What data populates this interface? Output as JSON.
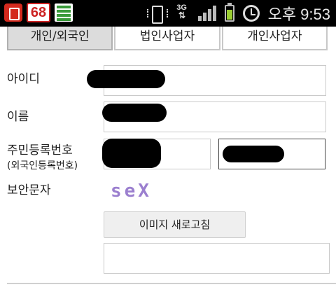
{
  "status_bar": {
    "notification_badge": "68",
    "time": "오후 9:53",
    "network_label": "3G",
    "icons": [
      "app-notification-icon",
      "badge-68-icon",
      "list-app-icon",
      "vibrate-icon",
      "3g-data-icon",
      "signal-icon",
      "battery-icon",
      "alarm-icon"
    ]
  },
  "tabs": [
    {
      "label": "개인/외국인",
      "active": true
    },
    {
      "label": "법인사업자",
      "active": false
    },
    {
      "label": "개인사업자",
      "active": false
    }
  ],
  "form": {
    "id_label": "아이디",
    "name_label": "이름",
    "rrn_label": "주민등록번호",
    "rrn_sublabel": "(외국인등록번호)",
    "security_label": "보안문자",
    "captcha_text": "seX",
    "refresh_button": "이미지 새로고침"
  },
  "colors": {
    "captcha": "#9b7fcf",
    "active_tab": "#dcdcdc",
    "status_bar": "#000000"
  }
}
